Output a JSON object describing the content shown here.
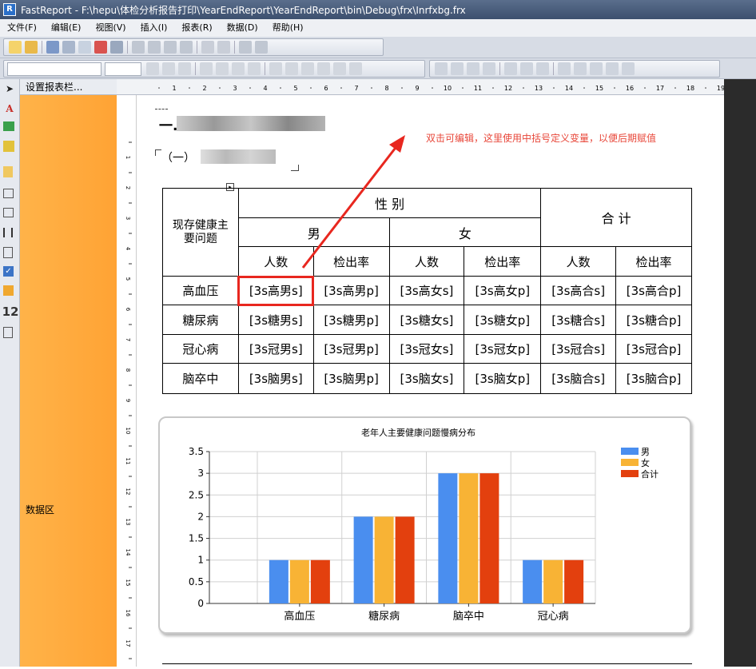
{
  "window": {
    "title": "FastReport - F:\\hepu\\体检分析报告打印\\YearEndReport\\YearEndReport\\bin\\Debug\\frx\\Inrfxbg.frx",
    "app_icon": "fastreport-logo-icon"
  },
  "menu": [
    "文件(F)",
    "编辑(E)",
    "视图(V)",
    "插入(I)",
    "报表(R)",
    "数据(D)",
    "帮助(H)"
  ],
  "band_panel": {
    "header": "设置报表栏...",
    "band_label": "数据区"
  },
  "ruler": {
    "h_ticks": [
      "1",
      "2",
      "3",
      "4",
      "5",
      "6",
      "7",
      "8",
      "9",
      "10",
      "11",
      "12",
      "13",
      "14",
      "15",
      "16",
      "17",
      "18",
      "19"
    ],
    "v_ticks": [
      "1",
      "2",
      "3",
      "4",
      "5",
      "6",
      "7",
      "8",
      "9",
      "10",
      "11",
      "12",
      "13",
      "14",
      "15",
      "16",
      "17",
      "18"
    ]
  },
  "report": {
    "heading1": "一.",
    "heading2": "（一）",
    "annotation": "双击可编辑，这里使用中括号定义变量，以便后期赋值",
    "table": {
      "corner": "现存健康主要问题",
      "gender": "性 别",
      "total": "合 计",
      "male": "男",
      "female": "女",
      "sub_headers": [
        "人数",
        "检出率",
        "人数",
        "检出率",
        "人数",
        "检出率"
      ],
      "rows": [
        {
          "label": "高血压",
          "cells": [
            "[3s高男s]",
            "[3s高男p]",
            "[3s高女s]",
            "[3s高女p]",
            "[3s高合s]",
            "[3s高合p]"
          ]
        },
        {
          "label": "糖尿病",
          "cells": [
            "[3s糖男s]",
            "[3s糖男p]",
            "[3s糖女s]",
            "[3s糖女p]",
            "[3s糖合s]",
            "[3s糖合p]"
          ]
        },
        {
          "label": "冠心病",
          "cells": [
            "[3s冠男s]",
            "[3s冠男p]",
            "[3s冠女s]",
            "[3s冠女p]",
            "[3s冠合s]",
            "[3s冠合p]"
          ]
        },
        {
          "label": "脑卒中",
          "cells": [
            "[3s脑男s]",
            "[3s脑男p]",
            "[3s脑女s]",
            "[3s脑女p]",
            "[3s脑合s]",
            "[3s脑合p]"
          ]
        }
      ]
    }
  },
  "colors": {
    "male": "#4a8eef",
    "female": "#f8b335",
    "total": "#e3400e",
    "highlight": "#e8271f",
    "band": "#ffa838"
  },
  "chart_data": {
    "type": "bar",
    "title": "老年人主要健康问题慢病分布",
    "categories": [
      "高血压",
      "糖尿病",
      "脑卒中",
      "冠心病"
    ],
    "series": [
      {
        "name": "男",
        "values": [
          1,
          2,
          3,
          1
        ]
      },
      {
        "name": "女",
        "values": [
          1,
          2,
          3,
          1
        ]
      },
      {
        "name": "合计",
        "values": [
          1,
          2,
          3,
          1
        ]
      }
    ],
    "y_ticks": [
      "0",
      "0.5",
      "1",
      "1.5",
      "2",
      "2.5",
      "3",
      "3.5"
    ],
    "ylim": [
      0,
      3.5
    ],
    "xlabel": "",
    "ylabel": "",
    "grid": true,
    "legend": "top-right"
  }
}
